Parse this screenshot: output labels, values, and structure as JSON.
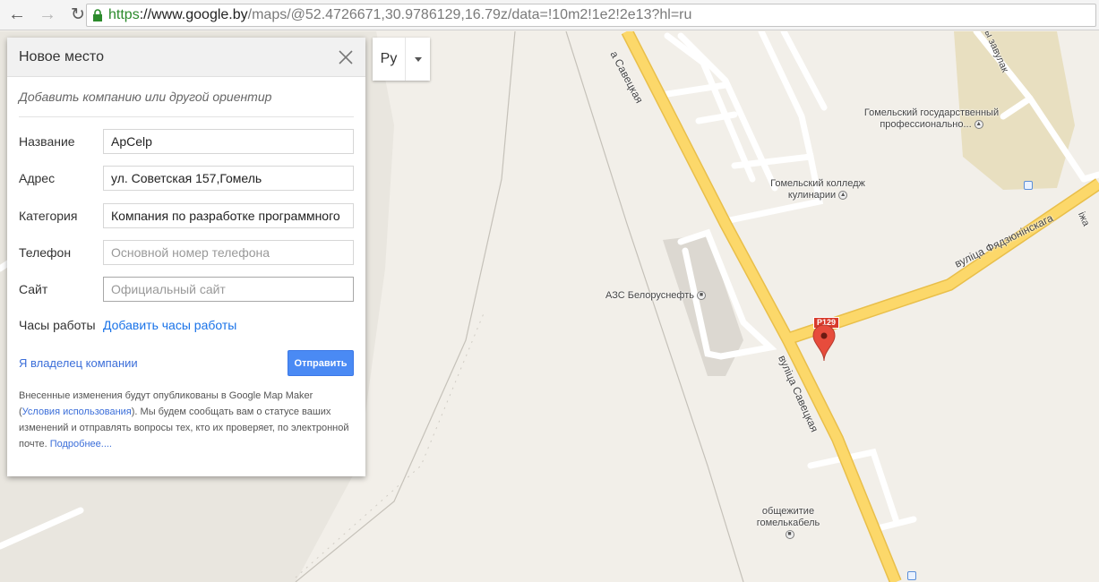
{
  "browser": {
    "url_secure": "https",
    "url_host": "://www.google.by",
    "url_path": "/maps/@52.4726671,30.9786129,16.79z/data=!10m2!1e2!2e13?hl=ru"
  },
  "language": {
    "label": "Ру"
  },
  "dialog": {
    "title": "Новое место",
    "subtitle": "Добавить компанию или другой ориентир",
    "fields": {
      "name": {
        "label": "Название",
        "value": "ApCelp"
      },
      "address": {
        "label": "Адрес",
        "value": "ул. Советская 157,Гомель"
      },
      "category": {
        "label": "Категория",
        "value": "Компания по разработке программного"
      },
      "phone": {
        "label": "Телефон",
        "placeholder": "Основной номер телефона"
      },
      "site": {
        "label": "Сайт",
        "placeholder": "Официальный сайт"
      }
    },
    "hours": {
      "label": "Часы работы",
      "link": "Добавить часы работы"
    },
    "owner_link": "Я владелец компании",
    "submit_label": "Отправить",
    "note": {
      "part1": "Внесенные изменения будут опубликованы в Google Map Maker (",
      "terms_link": "Условия использования",
      "part2": "). Мы будем сообщать вам о статусе ваших изменений и отправлять вопросы тех, кто их проверяет, по электронной почте. ",
      "more_link": "Подробнее...."
    }
  },
  "map": {
    "labels": {
      "street_savetskaya_top": "а Савецкая",
      "street_savetskaya_bottom": "вуліца Савецкая",
      "street_fyadzyuninskaga": "вуліца Фядзюнінскага",
      "lane_top": "ерны завулак",
      "lane_right": "іжа",
      "poi_college_prof": "Гомельский государственный профессионально...",
      "poi_college_culinary": "Гомельский колледж кулинарии",
      "poi_azs": "АЗС Белоруснефть",
      "poi_dorm": "общежитие гомелькабель",
      "road_badge": "Р129"
    },
    "colors": {
      "background": "#f2efe9",
      "major_road": "#fcd86a",
      "marker": "#e74c3c"
    }
  }
}
